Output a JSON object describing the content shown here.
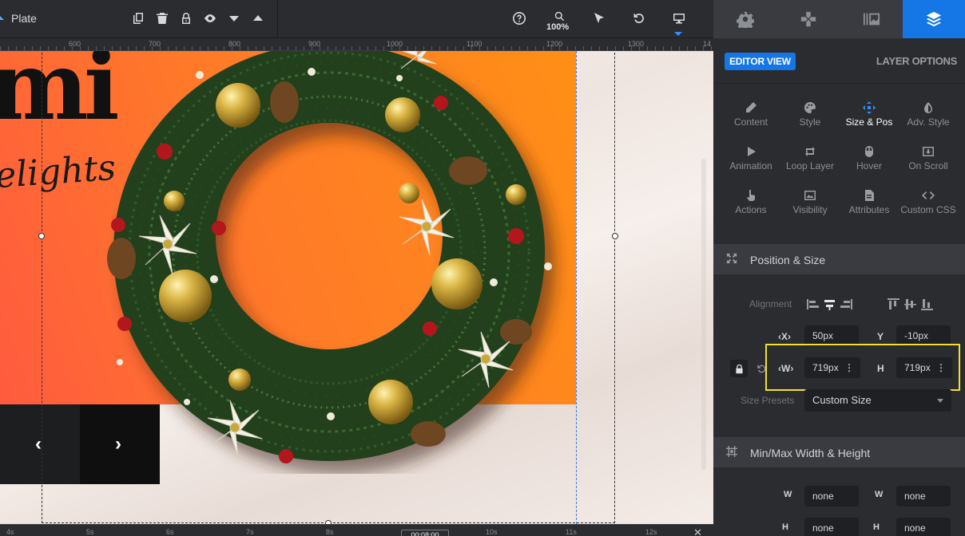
{
  "toolbar": {
    "layer_name": "Plate",
    "zoom": "100%",
    "icons": [
      "duplicate-icon",
      "trash-icon",
      "lock-icon",
      "eye-icon",
      "arrow-down-icon",
      "arrow-up-icon",
      "help-icon",
      "zoom-icon",
      "pointer-icon",
      "undo-icon",
      "desktop-icon"
    ]
  },
  "ruler": {
    "labels": [
      "600",
      "700",
      "800",
      "900",
      "1000",
      "1100",
      "1200",
      "1300",
      "14"
    ]
  },
  "canvas": {
    "title_text": "mi",
    "script_text": "elights",
    "nav_prev": "‹",
    "nav_next": "›"
  },
  "timeline": {
    "labels": [
      "4s",
      "5s",
      "6s",
      "7s",
      "8s",
      "10s",
      "11s",
      "12s"
    ],
    "current_time": "00:08:00",
    "close": "✕"
  },
  "panel": {
    "tabs": [
      "settings-tab",
      "navigation-tab",
      "slides-tab",
      "layers-tab"
    ],
    "editor_view": "EDITOR VIEW",
    "layer_options": "LAYER OPTIONS",
    "options": [
      {
        "label": "Content",
        "icon": "pencil-icon"
      },
      {
        "label": "Style",
        "icon": "palette-icon"
      },
      {
        "label": "Size & Pos",
        "icon": "move-icon",
        "active": true
      },
      {
        "label": "Adv. Style",
        "icon": "contrast-icon"
      },
      {
        "label": "Animation",
        "icon": "play-icon"
      },
      {
        "label": "Loop Layer",
        "icon": "loop-icon"
      },
      {
        "label": "Hover",
        "icon": "mouse-icon"
      },
      {
        "label": "On Scroll",
        "icon": "scroll-icon"
      },
      {
        "label": "Actions",
        "icon": "hand-icon"
      },
      {
        "label": "Visibility",
        "icon": "visibility-icon"
      },
      {
        "label": "Attributes",
        "icon": "document-icon"
      },
      {
        "label": "Custom CSS",
        "icon": "code-icon"
      }
    ],
    "position_size": {
      "title": "Position & Size",
      "alignment_label": "Alignment",
      "x_label": "X",
      "x_value": "50px",
      "y_label": "Y",
      "y_value": "-10px",
      "w_label": "W",
      "w_value": "719px",
      "h_label": "H",
      "h_value": "719px",
      "size_presets_label": "Size Presets",
      "size_preset_value": "Custom Size"
    },
    "minmax": {
      "title": "Min/Max Width & Height",
      "min_w": "none",
      "max_w": "none",
      "min_h": "none",
      "max_h": "none"
    }
  }
}
